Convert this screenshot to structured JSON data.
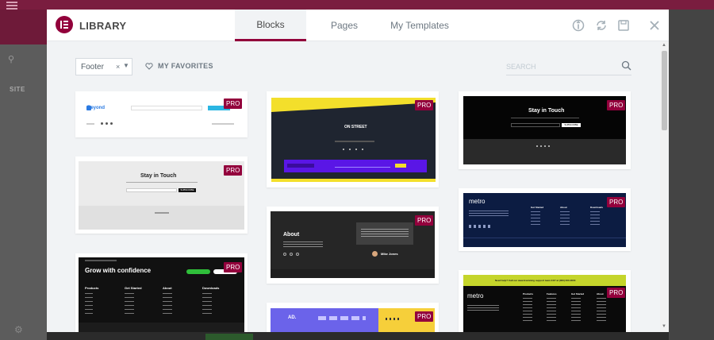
{
  "modal": {
    "title": "LIBRARY",
    "tabs": [
      {
        "label": "Blocks",
        "active": true
      },
      {
        "label": "Pages",
        "active": false
      },
      {
        "label": "My Templates",
        "active": false
      }
    ],
    "header_icons": [
      "info-icon",
      "sync-icon",
      "save-icon",
      "close-icon"
    ]
  },
  "toolbar": {
    "category_value": "Footer",
    "clear_symbol": "×",
    "favorites_label": "MY FAVORITES",
    "search_placeholder": "SEARCH"
  },
  "badge_label": "PRO",
  "background": {
    "site_label": "SITE"
  },
  "colors": {
    "accent": "#92003b",
    "pro_badge": "#93003c"
  },
  "cards": {
    "c1": {
      "brand": "Beyond",
      "cta": ""
    },
    "c2": {
      "heading": "Stay in Touch",
      "button": "SUBSCRIBE"
    },
    "c3": {
      "heading": "Grow with confidence",
      "col1": "Products",
      "col2": "Get Started",
      "col3": "About",
      "col4": "Downloads"
    },
    "c4": {
      "brand": "ON STREET"
    },
    "c5": {
      "heading": "About",
      "person": "Mike Jones"
    },
    "c6": {
      "brand": "AD."
    },
    "c7": {
      "heading": "Stay in Touch",
      "button": "SUBSCRIBE"
    },
    "c8": {
      "brand": "metro",
      "col1": "Get Started",
      "col2": "About",
      "col3": "Downloads"
    },
    "c9": {
      "banner": "Need help? Call our award-winning support team 24/7 at (000) 000-0000",
      "brand": "metro",
      "col1": "Products",
      "col2": "Features",
      "col3": "Get Started",
      "col4": "About"
    }
  }
}
